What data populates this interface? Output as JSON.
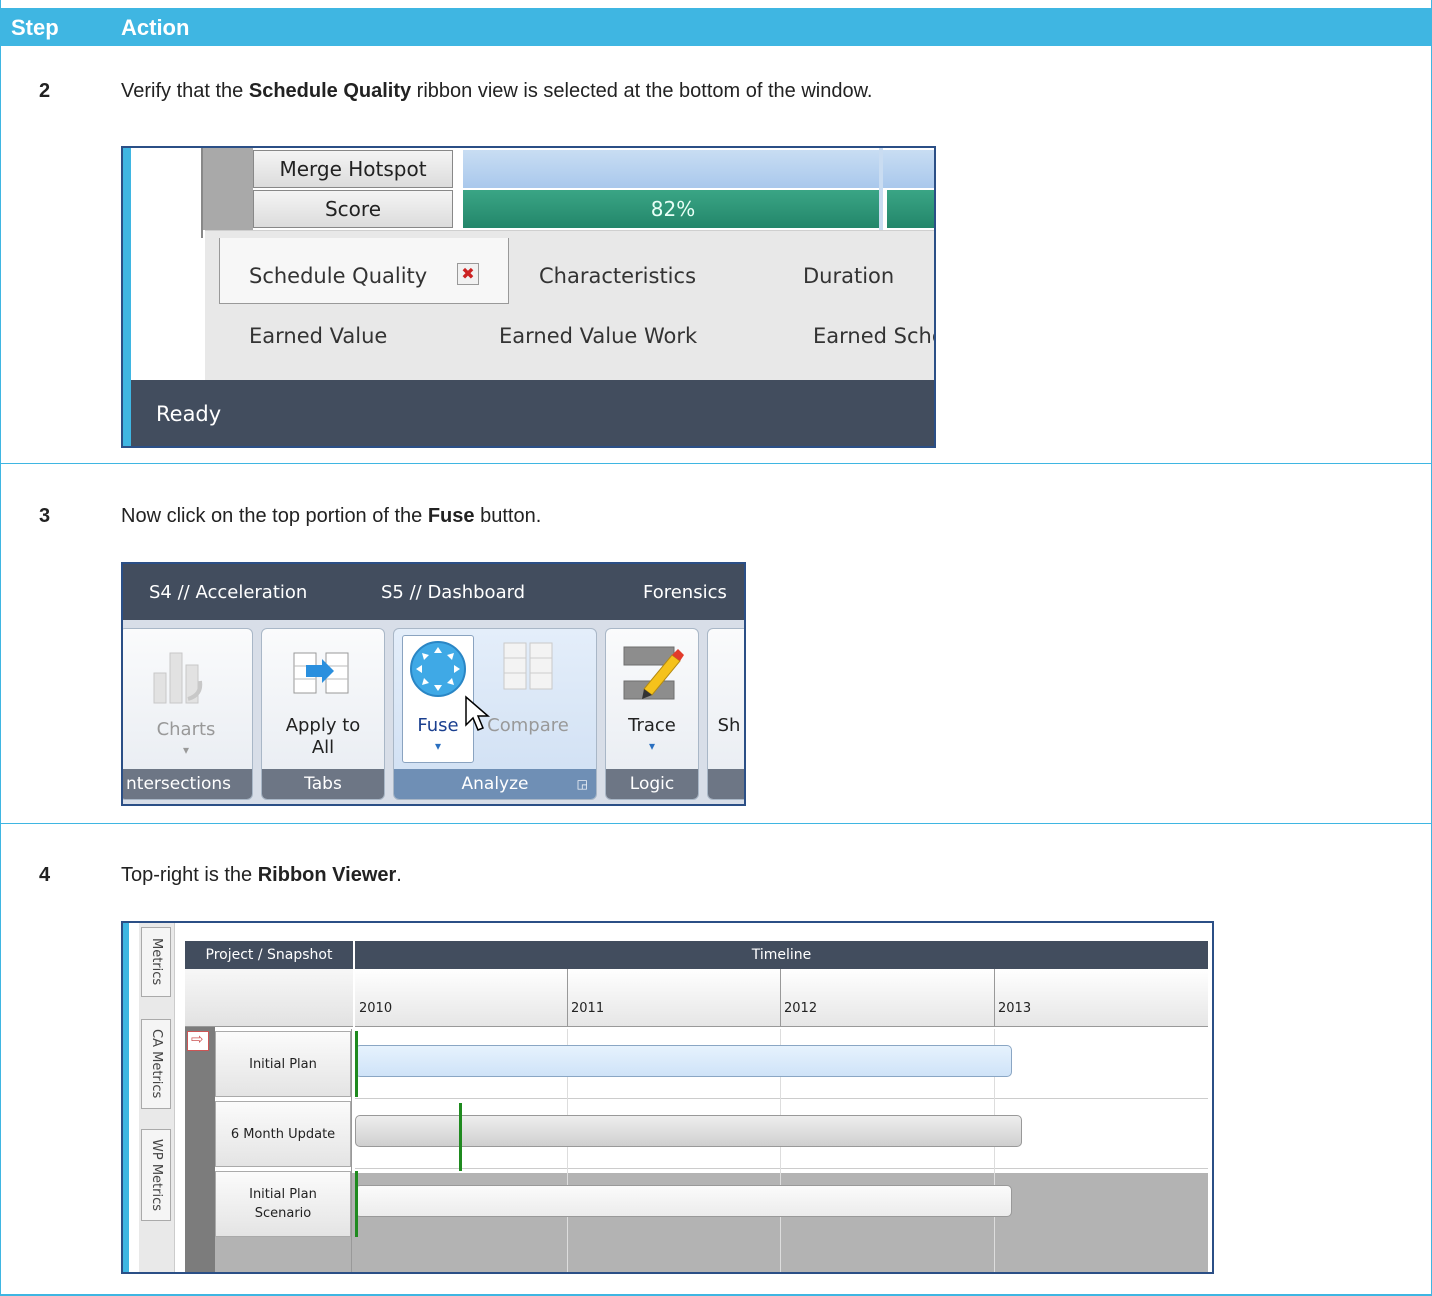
{
  "table": {
    "col_step": "Step",
    "col_action": "Action"
  },
  "steps": [
    {
      "num": "2",
      "text_before": "Verify that the ",
      "bold": "Schedule Quality",
      "text_after": " ribbon view is selected at the bottom of the window."
    },
    {
      "num": "3",
      "text_before": "Now click on the top portion of the ",
      "bold": "Fuse",
      "text_after": " button."
    },
    {
      "num": "4",
      "text_before": "Top-right is the ",
      "bold": "Ribbon Viewer",
      "text_after": "."
    }
  ],
  "shot1": {
    "merge_hotspot": "Merge Hotspot",
    "score": "Score",
    "score_value": "82%",
    "tabs_row1": [
      "Schedule Quality",
      "Characteristics",
      "Duration"
    ],
    "tabs_row2": [
      "Earned Value",
      "Earned Value Work",
      "Earned Sche"
    ],
    "status": "Ready"
  },
  "shot2": {
    "top_tabs": [
      "S4 // Acceleration",
      "S5 // Dashboard",
      "Forensics"
    ],
    "groups": {
      "intersections": {
        "button": "Charts",
        "label": "ntersections"
      },
      "tabs": {
        "button_line1": "Apply to",
        "button_line2": "All",
        "label": "Tabs"
      },
      "analyze": {
        "fuse": "Fuse",
        "compare": "Compare",
        "label": "Analyze"
      },
      "logic": {
        "button": "Trace",
        "label": "Logic"
      },
      "partial": {
        "button": "Sh"
      }
    }
  },
  "shot3": {
    "sidebar_tabs": [
      "Metrics",
      "CA Metrics",
      "WP Metrics"
    ],
    "col_project": "Project / Snapshot",
    "col_timeline": "Timeline",
    "years": [
      "2010",
      "2011",
      "2012",
      "2013"
    ],
    "rows": [
      {
        "name_line1": "Initial  Plan",
        "name_line2": ""
      },
      {
        "name_line1": "6 Month Update",
        "name_line2": ""
      },
      {
        "name_line1": "Initial  Plan",
        "name_line2": "Scenario"
      }
    ]
  },
  "colors": {
    "header_blue": "#3fb6e2",
    "dark_bar": "#424d5e",
    "score_green": "#2f9e7a",
    "bar_blue": "#d4e8fb"
  }
}
